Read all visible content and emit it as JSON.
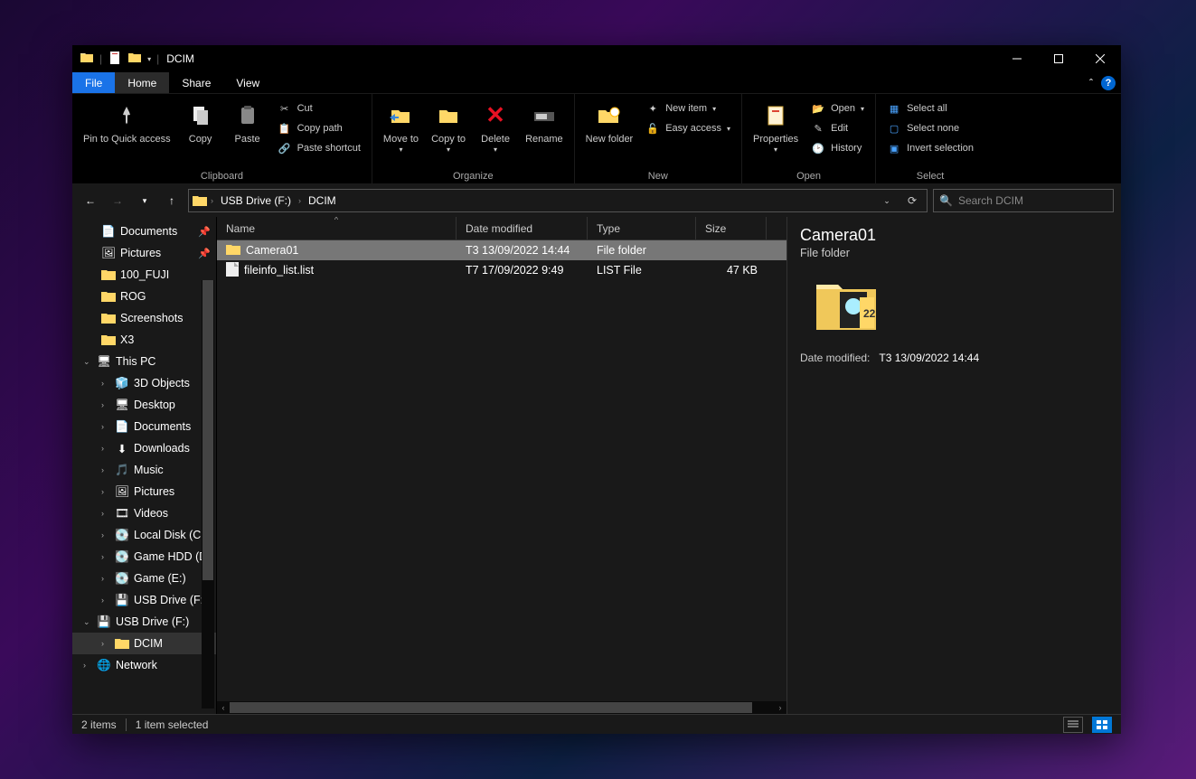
{
  "window_title": "DCIM",
  "tabs": {
    "file": "File",
    "home": "Home",
    "share": "Share",
    "view": "View"
  },
  "ribbon": {
    "clipboard": {
      "pin": "Pin to Quick access",
      "copy": "Copy",
      "paste": "Paste",
      "cut": "Cut",
      "copypath": "Copy path",
      "pasteshortcut": "Paste shortcut",
      "label": "Clipboard"
    },
    "organize": {
      "moveto": "Move to",
      "copyto": "Copy to",
      "delete": "Delete",
      "rename": "Rename",
      "label": "Organize"
    },
    "new": {
      "newfolder": "New folder",
      "newitem": "New item",
      "easyaccess": "Easy access",
      "label": "New"
    },
    "open": {
      "properties": "Properties",
      "open": "Open",
      "edit": "Edit",
      "history": "History",
      "label": "Open"
    },
    "select": {
      "selectall": "Select all",
      "selectnone": "Select none",
      "invert": "Invert selection",
      "label": "Select"
    }
  },
  "breadcrumbs": {
    "drive": "USB Drive (F:)",
    "folder": "DCIM"
  },
  "search_placeholder": "Search DCIM",
  "tree": {
    "documents": "Documents",
    "pictures": "Pictures",
    "fuji": "100_FUJI",
    "rog": "ROG",
    "screenshots": "Screenshots",
    "x3": "X3",
    "thispc": "This PC",
    "obj3d": "3D Objects",
    "desktop": "Desktop",
    "tdocs": "Documents",
    "downloads": "Downloads",
    "music": "Music",
    "tpics": "Pictures",
    "videos": "Videos",
    "localc": "Local Disk (C:)",
    "gamed": "Game HDD (D:)",
    "gamee": "Game (E:)",
    "usbf1": "USB Drive (F:)",
    "usbf2": "USB Drive (F:)",
    "dcim": "DCIM",
    "network": "Network"
  },
  "columns": {
    "name": "Name",
    "date": "Date modified",
    "type": "Type",
    "size": "Size"
  },
  "rows": [
    {
      "name": "Camera01",
      "date": "T3 13/09/2022 14:44",
      "type": "File folder",
      "size": "",
      "icon": "folder",
      "sel": true
    },
    {
      "name": "fileinfo_list.list",
      "date": "T7 17/09/2022 9:49",
      "type": "LIST File",
      "size": "47 KB",
      "icon": "file",
      "sel": false
    }
  ],
  "details": {
    "title": "Camera01",
    "subtitle": "File folder",
    "date_label": "Date modified:",
    "date_value": "T3 13/09/2022 14:44"
  },
  "status": {
    "count": "2 items",
    "selected": "1 item selected"
  }
}
